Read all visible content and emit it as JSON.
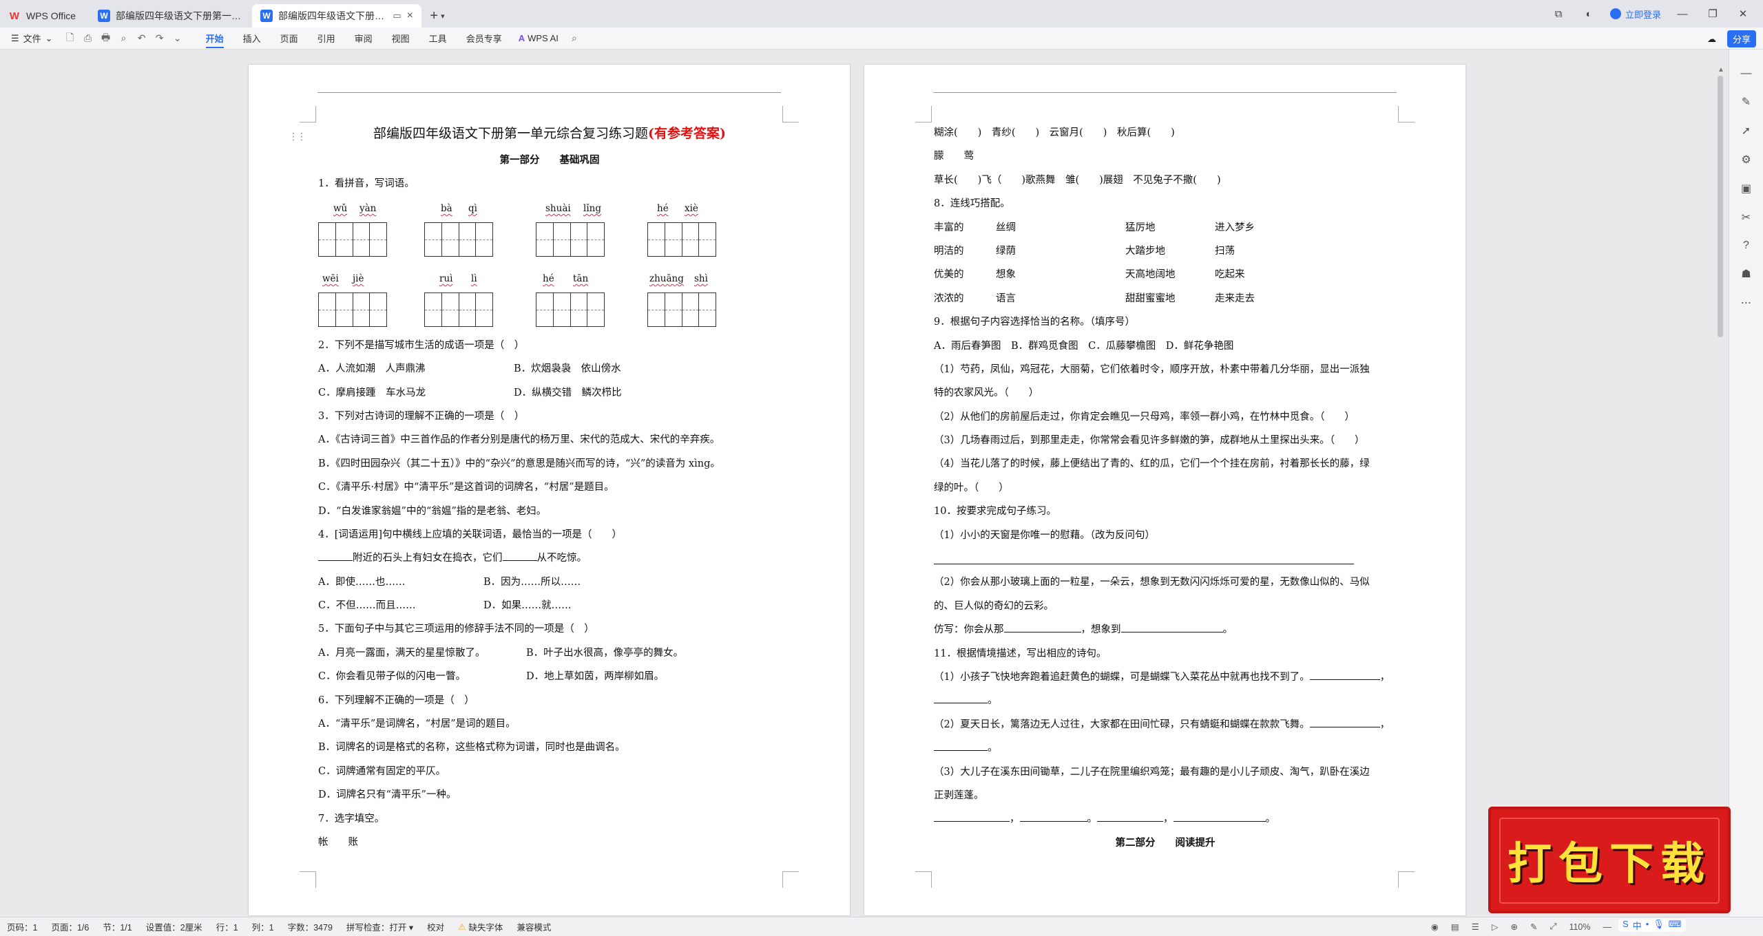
{
  "titlebar": {
    "tabs": [
      {
        "label": "WPS Office"
      },
      {
        "label": "部编版四年级语文下册第一单元综合复"
      },
      {
        "label": "部编版四年级语文下册第一单元"
      }
    ],
    "login": "立即登录"
  },
  "ribbon": {
    "file": "文件",
    "tabs": [
      "开始",
      "插入",
      "页面",
      "引用",
      "审阅",
      "视图",
      "工具",
      "会员专享"
    ],
    "wps_ai": "WPS AI",
    "share": "分享"
  },
  "page1": {
    "title_main": "部编版四年级语文下册第一单元综合复习练习题",
    "title_red": "(有参考答案)",
    "part1": "第一部分　　基础巩固",
    "q1": "1．看拼音，写词语。",
    "pinyin_row1": [
      "wǔ",
      "yàn",
      "bà",
      "qì",
      "shuài",
      "lǐng",
      "hé",
      "xiè"
    ],
    "pinyin_row2": [
      "wēi",
      "jiè",
      "ruì",
      "lì",
      "hé",
      "tān",
      "zhuāng",
      "shì"
    ],
    "q2": "2．下列不是描写城市生活的成语一项是（　）",
    "q2_a": "A．人流如潮　人声鼎沸",
    "q2_b": "B．炊烟袅袅　依山傍水",
    "q2_c": "C．摩肩接踵　车水马龙",
    "q2_d": "D．纵横交错　鳞次栉比",
    "q3": "3．下列对古诗词的理解不正确的一项是（　）",
    "q3_a": "A．《古诗词三首》中三首作品的作者分别是唐代的杨万里、宋代的范成大、宋代的辛弃疾。",
    "q3_b": "B．《四时田园杂兴（其二十五）》中的“杂兴”的意思是随兴而写的诗，“兴”的读音为 xìng。",
    "q3_c": "C．《清平乐·村居》中“清平乐”是这首词的词牌名，“村居”是题目。",
    "q3_d": "D．“白发谁家翁媪”中的“翁媪”指的是老翁、老妇。",
    "q4": "4．[词语运用]句中横线上应填的关联词语，最恰当的一项是（　　）",
    "q4_stem_a": "附近的石头上有妇女在捣衣，它们",
    "q4_stem_b": "从不吃惊。",
    "q4_a": "A．即使……也……",
    "q4_b": "B．因为……所以……",
    "q4_c": "C．不但……而且……",
    "q4_d": "D．如果……就……",
    "q5": "5．下面句子中与其它三项运用的修辞手法不同的一项是（　）",
    "q5_a": "A．月亮一露面，满天的星星惊散了。",
    "q5_b": "B．叶子出水很高，像亭亭的舞女。",
    "q5_c": "C．你会看见带子似的闪电一瞥。",
    "q5_d": "D．地上草如茵，两岸柳如眉。",
    "q6": "6．下列理解不正确的一项是（　）",
    "q6_a": "A．“清平乐”是词牌名，“村居”是词的题目。",
    "q6_b": "B．词牌名的词是格式的名称，这些格式称为词谱，同时也是曲调名。",
    "q6_c": "C．词牌通常有固定的平仄。",
    "q6_d": "D．词牌名只有“清平乐”一种。",
    "q7": "7．选字填空。",
    "q7_chars": "帐　　账"
  },
  "page2": {
    "l1": "糊涂(　　)　青纱(　　)　云窗月(　　)　秋后算(　　)",
    "l2": "朦　　莺",
    "l3": "草长(　　)飞（　　)歌燕舞　雏(　　)展翅　不见兔子不撒(　　)",
    "q8": "8．连线巧搭配。",
    "match": [
      [
        "丰富的",
        "丝绸",
        "猛厉地",
        "进入梦乡"
      ],
      [
        "明洁的",
        "绿荫",
        "大踏步地",
        "扫荡"
      ],
      [
        "优美的",
        "想象",
        "天高地阔地",
        "吃起来"
      ],
      [
        "浓浓的",
        "语言",
        "甜甜蜜蜜地",
        "走来走去"
      ]
    ],
    "q9": "9．根据句子内容选择恰当的名称。（填序号）",
    "q9_opts": "A．雨后春笋图　B．群鸡觅食图　C．瓜藤攀檐图　D．鲜花争艳图",
    "q9_1a": "（1）芍药，凤仙，鸡冠花，大丽菊，它们依着时令，顺序开放，朴素中带着几分华丽，显出一派独",
    "q9_1b": "特的农家风光。（　　）",
    "q9_2": "（2）从他们的房前屋后走过，你肯定会瞧见一只母鸡，率领一群小鸡，在竹林中觅食。（　　）",
    "q9_3": "（3）几场春雨过后，到那里走走，你常常会看见许多鲜嫩的笋，成群地从土里探出头来。（　　）",
    "q9_4a": "（4）当花儿落了的时候，藤上便结出了青的、红的瓜，它们一个个挂在房前，衬着那长长的藤，绿",
    "q9_4b": "绿的叶。（　　）",
    "q10": "10．按要求完成句子练习。",
    "q10_1": "（1）小小的天窗是你唯一的慰藉。（改为反问句）",
    "q10_2a": "（2）你会从那小玻璃上面的一粒星，一朵云，想象到无数闪闪烁烁可爱的星，无数像山似的、马似",
    "q10_2b": "的、巨人似的奇幻的云彩。",
    "q10_fill_a": "仿写：你会从那",
    "q10_fill_b": "，想象到",
    "q10_fill_c": "。",
    "q11": "11．根据情境描述，写出相应的诗句。",
    "q11_1": "（1）小孩子飞快地奔跑着追赶黄色的蝴蝶，可是蝴蝶飞入菜花丛中就再也找不到了。",
    "q11_2": "（2）夏天日长，篱落边无人过往，大家都在田间忙碌，只有蜻蜓和蝴蝶在款款飞舞。",
    "q11_3a": "（3）大儿子在溪东田间锄草，二儿子在院里编织鸡笼；最有趣的是小儿子顽皮、淘气，趴卧在溪边",
    "q11_3b": "正剥莲蓬。",
    "part2": "第二部分　　阅读提升"
  },
  "statusbar": {
    "page_no": "页码：1",
    "page": "页面：1/6",
    "section": "节：1/1",
    "setting": "设置值：2厘米",
    "row": "行：1",
    "col": "列：1",
    "words": "字数：3479",
    "spell": "拼写检查：打开",
    "proof": "校对",
    "font_missing": "缺失字体",
    "compat": "兼容模式",
    "zoom": "110%"
  },
  "promo": {
    "text": "打包下载"
  },
  "colors": {
    "accent": "#2a6ef3",
    "title_red": "#e21212",
    "promo_bg": "#d91b1b",
    "promo_text": "#ffe33a"
  }
}
